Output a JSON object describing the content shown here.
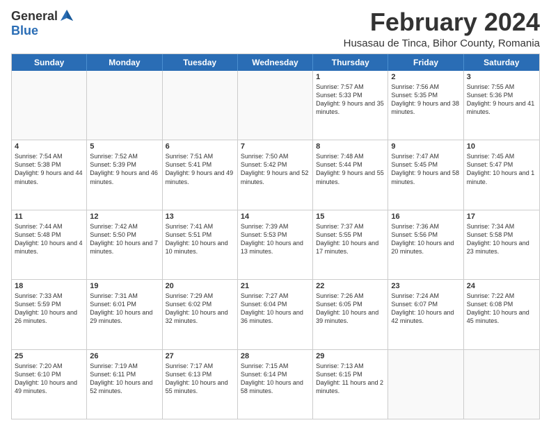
{
  "logo": {
    "general": "General",
    "blue": "Blue"
  },
  "title": "February 2024",
  "subtitle": "Husasau de Tinca, Bihor County, Romania",
  "days": [
    "Sunday",
    "Monday",
    "Tuesday",
    "Wednesday",
    "Thursday",
    "Friday",
    "Saturday"
  ],
  "rows": [
    [
      {
        "day": "",
        "empty": true
      },
      {
        "day": "",
        "empty": true
      },
      {
        "day": "",
        "empty": true
      },
      {
        "day": "",
        "empty": true
      },
      {
        "day": "1",
        "sunrise": "7:57 AM",
        "sunset": "5:33 PM",
        "daylight": "9 hours and 35 minutes."
      },
      {
        "day": "2",
        "sunrise": "7:56 AM",
        "sunset": "5:35 PM",
        "daylight": "9 hours and 38 minutes."
      },
      {
        "day": "3",
        "sunrise": "7:55 AM",
        "sunset": "5:36 PM",
        "daylight": "9 hours and 41 minutes."
      }
    ],
    [
      {
        "day": "4",
        "sunrise": "7:54 AM",
        "sunset": "5:38 PM",
        "daylight": "9 hours and 44 minutes."
      },
      {
        "day": "5",
        "sunrise": "7:52 AM",
        "sunset": "5:39 PM",
        "daylight": "9 hours and 46 minutes."
      },
      {
        "day": "6",
        "sunrise": "7:51 AM",
        "sunset": "5:41 PM",
        "daylight": "9 hours and 49 minutes."
      },
      {
        "day": "7",
        "sunrise": "7:50 AM",
        "sunset": "5:42 PM",
        "daylight": "9 hours and 52 minutes."
      },
      {
        "day": "8",
        "sunrise": "7:48 AM",
        "sunset": "5:44 PM",
        "daylight": "9 hours and 55 minutes."
      },
      {
        "day": "9",
        "sunrise": "7:47 AM",
        "sunset": "5:45 PM",
        "daylight": "9 hours and 58 minutes."
      },
      {
        "day": "10",
        "sunrise": "7:45 AM",
        "sunset": "5:47 PM",
        "daylight": "10 hours and 1 minute."
      }
    ],
    [
      {
        "day": "11",
        "sunrise": "7:44 AM",
        "sunset": "5:48 PM",
        "daylight": "10 hours and 4 minutes."
      },
      {
        "day": "12",
        "sunrise": "7:42 AM",
        "sunset": "5:50 PM",
        "daylight": "10 hours and 7 minutes."
      },
      {
        "day": "13",
        "sunrise": "7:41 AM",
        "sunset": "5:51 PM",
        "daylight": "10 hours and 10 minutes."
      },
      {
        "day": "14",
        "sunrise": "7:39 AM",
        "sunset": "5:53 PM",
        "daylight": "10 hours and 13 minutes."
      },
      {
        "day": "15",
        "sunrise": "7:37 AM",
        "sunset": "5:55 PM",
        "daylight": "10 hours and 17 minutes."
      },
      {
        "day": "16",
        "sunrise": "7:36 AM",
        "sunset": "5:56 PM",
        "daylight": "10 hours and 20 minutes."
      },
      {
        "day": "17",
        "sunrise": "7:34 AM",
        "sunset": "5:58 PM",
        "daylight": "10 hours and 23 minutes."
      }
    ],
    [
      {
        "day": "18",
        "sunrise": "7:33 AM",
        "sunset": "5:59 PM",
        "daylight": "10 hours and 26 minutes."
      },
      {
        "day": "19",
        "sunrise": "7:31 AM",
        "sunset": "6:01 PM",
        "daylight": "10 hours and 29 minutes."
      },
      {
        "day": "20",
        "sunrise": "7:29 AM",
        "sunset": "6:02 PM",
        "daylight": "10 hours and 32 minutes."
      },
      {
        "day": "21",
        "sunrise": "7:27 AM",
        "sunset": "6:04 PM",
        "daylight": "10 hours and 36 minutes."
      },
      {
        "day": "22",
        "sunrise": "7:26 AM",
        "sunset": "6:05 PM",
        "daylight": "10 hours and 39 minutes."
      },
      {
        "day": "23",
        "sunrise": "7:24 AM",
        "sunset": "6:07 PM",
        "daylight": "10 hours and 42 minutes."
      },
      {
        "day": "24",
        "sunrise": "7:22 AM",
        "sunset": "6:08 PM",
        "daylight": "10 hours and 45 minutes."
      }
    ],
    [
      {
        "day": "25",
        "sunrise": "7:20 AM",
        "sunset": "6:10 PM",
        "daylight": "10 hours and 49 minutes."
      },
      {
        "day": "26",
        "sunrise": "7:19 AM",
        "sunset": "6:11 PM",
        "daylight": "10 hours and 52 minutes."
      },
      {
        "day": "27",
        "sunrise": "7:17 AM",
        "sunset": "6:13 PM",
        "daylight": "10 hours and 55 minutes."
      },
      {
        "day": "28",
        "sunrise": "7:15 AM",
        "sunset": "6:14 PM",
        "daylight": "10 hours and 58 minutes."
      },
      {
        "day": "29",
        "sunrise": "7:13 AM",
        "sunset": "6:15 PM",
        "daylight": "11 hours and 2 minutes."
      },
      {
        "day": "",
        "empty": true
      },
      {
        "day": "",
        "empty": true
      }
    ]
  ]
}
